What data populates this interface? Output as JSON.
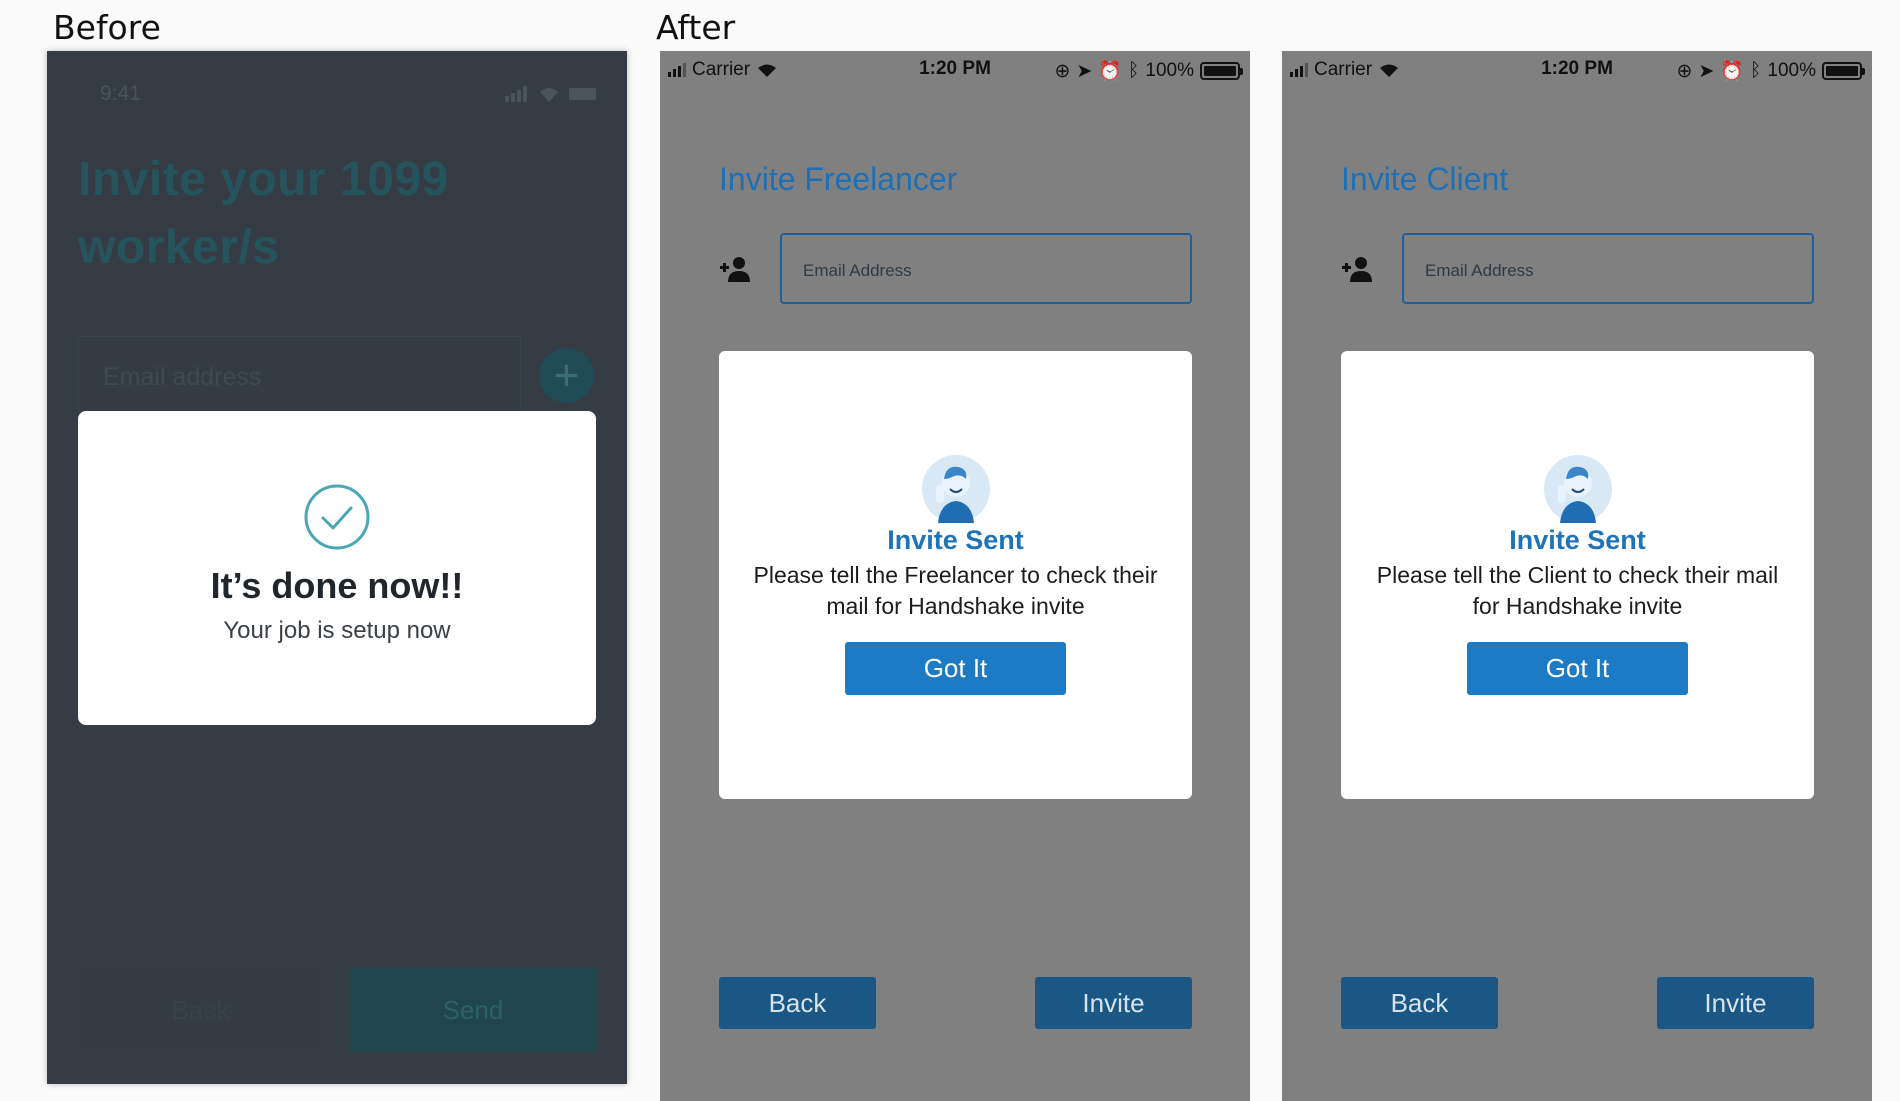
{
  "labels": {
    "before": "Before",
    "after": "After"
  },
  "before": {
    "status_time": "9:41",
    "title": "Invite your 1099 worker/s",
    "email_placeholder": "Email address",
    "add_icon": "plus",
    "modal": {
      "icon": "check-circle-icon",
      "title": "It’s done now!!",
      "subtitle": "Your job is setup now"
    },
    "back_label": "Back",
    "send_label": "Send"
  },
  "after_screens": [
    {
      "status": {
        "carrier": "Carrier",
        "time": "1:20 PM",
        "battery": "100%"
      },
      "title": "Invite Freelancer",
      "email_placeholder": "Email Address",
      "modal": {
        "title": "Invite Sent",
        "message": "Please tell the Freelancer to check their mail for Handshake invite",
        "button": "Got It"
      },
      "back_label": "Back",
      "invite_label": "Invite"
    },
    {
      "status": {
        "carrier": "Carrier",
        "time": "1:20 PM",
        "battery": "100%"
      },
      "title": "Invite Client",
      "email_placeholder": "Email Address",
      "modal": {
        "title": "Invite Sent",
        "message": "Please tell the Client to check their mail for Handshake invite",
        "button": "Got It"
      },
      "back_label": "Back",
      "invite_label": "Invite"
    }
  ],
  "colors": {
    "accent_blue": "#1d70b5",
    "button_blue": "#1d7ac4",
    "nav_button_blue": "#1a5784",
    "overlay_gray": "#808080",
    "before_bg": "#353c44"
  }
}
